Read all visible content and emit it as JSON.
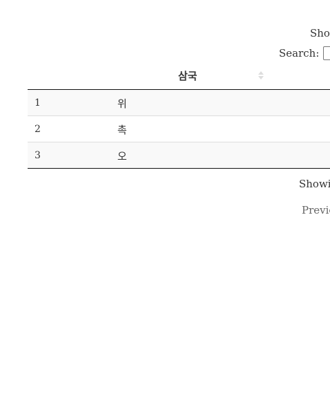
{
  "controls": {
    "length_label": "Show",
    "search_label": "Search:",
    "search_value": ""
  },
  "table": {
    "header": "삼국",
    "rows": [
      {
        "num": "1",
        "name": "위"
      },
      {
        "num": "2",
        "name": "촉"
      },
      {
        "num": "3",
        "name": "오"
      }
    ]
  },
  "footer": {
    "info": "Showin",
    "previous": "Previo"
  }
}
